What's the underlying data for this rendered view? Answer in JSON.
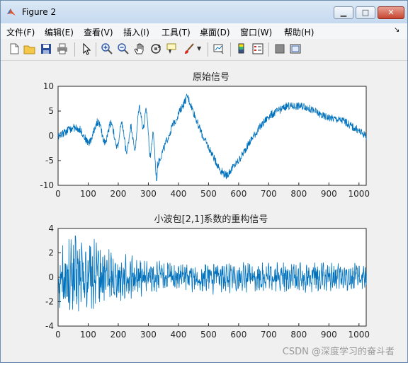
{
  "window": {
    "title": "Figure 2"
  },
  "menu": [
    "文件(F)",
    "编辑(E)",
    "查看(V)",
    "插入(I)",
    "工具(T)",
    "桌面(D)",
    "窗口(W)",
    "帮助(H)"
  ],
  "toolbar": [
    "new-figure-icon",
    "open-file-icon",
    "save-icon",
    "print-icon",
    "pointer-icon",
    "zoom-in-icon",
    "zoom-out-icon",
    "pan-hand-icon",
    "rotate-3d-icon",
    "data-cursor-icon",
    "brush-icon",
    "brush-dropdown-icon",
    "link-plot-icon",
    "colorbar-icon",
    "legend-icon",
    "hide-plot-tools-icon",
    "show-plot-tools-icon"
  ],
  "colors": {
    "line": "#0072bd",
    "axes_bg": "#ffffff",
    "figure_bg": "#f0f0f0"
  },
  "watermark": "CSDN @深度学习的奋斗者",
  "chart_data": [
    {
      "type": "line",
      "title": "原始信号",
      "xlim": [
        0,
        1024
      ],
      "ylim": [
        -10,
        10
      ],
      "xticks": [
        0,
        100,
        200,
        300,
        400,
        500,
        600,
        700,
        800,
        900,
        1000
      ],
      "yticks": [
        -10,
        -5,
        0,
        5,
        10
      ],
      "series": [
        {
          "x": [
            0,
            30,
            60,
            100,
            150,
            200,
            250,
            280,
            330,
            380,
            430,
            480,
            540,
            560,
            600,
            650,
            700,
            760,
            820,
            880,
            950,
            1024
          ],
          "values": [
            0,
            0.5,
            0,
            0.5,
            1,
            0,
            -1,
            5,
            -6,
            2,
            8,
            0,
            -7,
            -8,
            -5,
            0,
            4,
            6,
            6,
            4,
            3,
            0
          ]
        }
      ]
    },
    {
      "type": "line",
      "title": "小波包[2,1]系数的重构信号",
      "xlim": [
        0,
        1024
      ],
      "ylim": [
        -4,
        4
      ],
      "xticks": [
        0,
        100,
        200,
        300,
        400,
        500,
        600,
        700,
        800,
        900,
        1000
      ],
      "yticks": [
        -4,
        -2,
        0,
        2,
        4
      ],
      "series": [
        {
          "x": [
            0,
            50,
            100,
            150,
            200,
            300,
            400,
            500,
            600,
            700,
            800,
            900,
            1024
          ],
          "values": [
            1.2,
            1.5,
            1.4,
            1.1,
            0.8,
            0.6,
            0.5,
            0.6,
            0.5,
            0.55,
            0.5,
            0.5,
            0.45
          ]
        }
      ]
    }
  ]
}
